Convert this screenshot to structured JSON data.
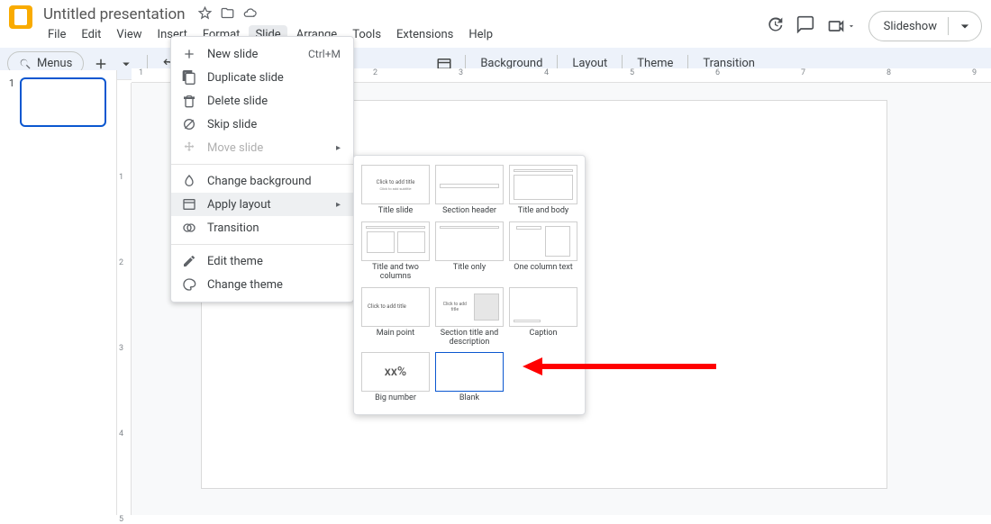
{
  "doc": {
    "title": "Untitled presentation"
  },
  "menubar": [
    "File",
    "Edit",
    "View",
    "Insert",
    "Format",
    "Slide",
    "Arrange",
    "Tools",
    "Extensions",
    "Help"
  ],
  "menubar_active": "Slide",
  "header": {
    "slideshow": "Slideshow"
  },
  "toolbar": {
    "menus_label": "Menus",
    "background": "Background",
    "layout": "Layout",
    "theme": "Theme",
    "transition": "Transition"
  },
  "ruler_h": [
    "1",
    "",
    "1",
    "2",
    "3",
    "4",
    "5",
    "6",
    "7",
    "8",
    "9"
  ],
  "ruler_v": [
    "1",
    "2",
    "3",
    "4",
    "5"
  ],
  "thumbnails": [
    {
      "num": "1"
    }
  ],
  "slide_menu": {
    "new_slide": "New slide",
    "new_slide_shortcut": "Ctrl+M",
    "duplicate": "Duplicate slide",
    "delete": "Delete slide",
    "skip": "Skip slide",
    "move": "Move slide",
    "change_bg": "Change background",
    "apply_layout": "Apply layout",
    "transition": "Transition",
    "edit_theme": "Edit theme",
    "change_theme": "Change theme"
  },
  "layouts": [
    {
      "name": "Title slide",
      "preview": "title-slide"
    },
    {
      "name": "Section header",
      "preview": "section-header"
    },
    {
      "name": "Title and body",
      "preview": "title-body"
    },
    {
      "name": "Title and two columns",
      "preview": "two-columns"
    },
    {
      "name": "Title only",
      "preview": "title-only"
    },
    {
      "name": "One column text",
      "preview": "one-column"
    },
    {
      "name": "Main point",
      "preview": "main-point"
    },
    {
      "name": "Section title and description",
      "preview": "section-desc"
    },
    {
      "name": "Caption",
      "preview": "caption"
    },
    {
      "name": "Big number",
      "preview": "big-number"
    },
    {
      "name": "Blank",
      "preview": "blank"
    }
  ],
  "layout_preview_text": {
    "click_title": "Click to add title",
    "click_subtitle": "Click to add subtitle",
    "xx": "xx%"
  }
}
